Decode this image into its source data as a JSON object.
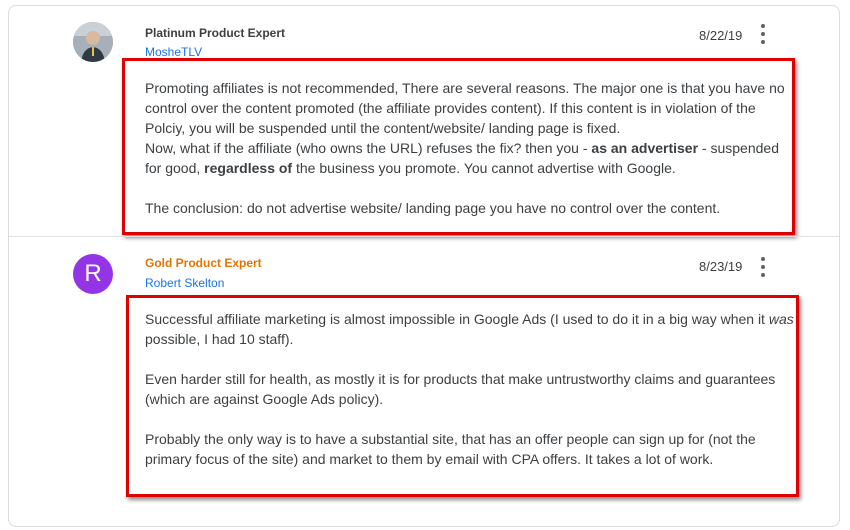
{
  "posts": [
    {
      "expert_label": "Platinum Product Expert",
      "username": "MosheTLV",
      "date": "8/22/19",
      "menu_icon": "more-vert-icon",
      "avatar": "photo",
      "body": {
        "p1": "Promoting affiliates is not recommended, There are several reasons. The major one is that you have no control over the content promoted (the affiliate provides content). If this content is in violation of the Polciy, you will be suspended until the content/website/ landing page is fixed.",
        "p2_a": "Now, what if the affiliate (who owns the URL) refuses the fix? then you - ",
        "p2_b": "as an advertiser",
        "p2_c": " - suspended for good, ",
        "p2_d": "regardless of",
        "p2_e": " the business you promote. You cannot advertise with Google.",
        "p3": "The conclusion: do not advertise website/ landing page you have no control over the content."
      }
    },
    {
      "expert_label": "Gold Product Expert",
      "username": "Robert Skelton",
      "date": "8/23/19",
      "menu_icon": "more-vert-icon",
      "avatar_letter": "R",
      "avatar_color": "#9334e6",
      "body": {
        "p1_a": "Successful affiliate marketing is almost impossible in Google Ads (I used to do it in a big way when it ",
        "p1_b": "was",
        "p1_c": " possible, I had 10 staff).",
        "p2": "Even harder still for health, as mostly it is for products that make untrustworthy claims and guarantees (which are against Google Ads policy).",
        "p3": "Probably the only way is to have a substantial site, that has an offer people can sign up for (not the primary focus of the site) and market to them by email with CPA offers. It takes a lot of work."
      }
    }
  ],
  "colors": {
    "link": "#1a73e8",
    "gold": "#e37400",
    "highlight_box": "#e00000"
  }
}
